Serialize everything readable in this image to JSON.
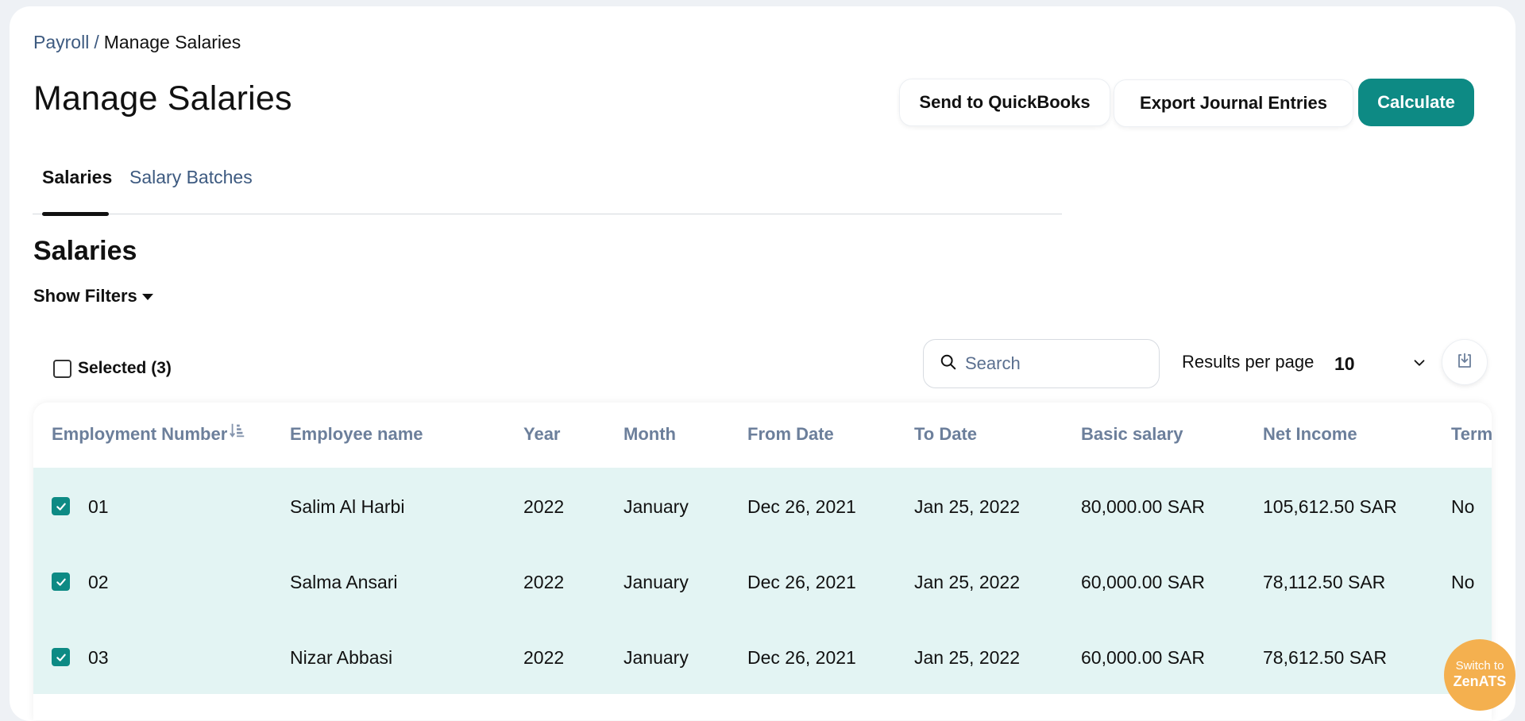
{
  "breadcrumb": {
    "parent": "Payroll",
    "separator": "/",
    "current": "Manage Salaries"
  },
  "page_title": "Manage Salaries",
  "actions": {
    "quickbooks": "Send to QuickBooks",
    "export": "Export Journal Entries",
    "calculate": "Calculate"
  },
  "colors": {
    "accent": "#0d8a84",
    "row_selected": "#e3f4f3",
    "link": "#3d5a80",
    "header_text": "#6c7f9b",
    "zenats": "#f4b04f"
  },
  "tabs": [
    {
      "label": "Salaries",
      "active": true
    },
    {
      "label": "Salary Batches",
      "active": false
    }
  ],
  "section_title": "Salaries",
  "filters": {
    "label": "Show Filters"
  },
  "selection": {
    "label": "Selected (3)"
  },
  "search": {
    "placeholder": "Search",
    "value": ""
  },
  "pagination": {
    "label": "Results per page",
    "value": "10"
  },
  "table": {
    "headers": [
      "Employment Number",
      "Employee name",
      "Year",
      "Month",
      "From Date",
      "To Date",
      "Basic salary",
      "Net Income",
      "Term"
    ],
    "rows": [
      {
        "checked": true,
        "cells": [
          "01",
          "Salim Al Harbi",
          "2022",
          "January",
          "Dec 26, 2021",
          "Jan 25, 2022",
          "80,000.00 SAR",
          "105,612.50 SAR",
          "No"
        ]
      },
      {
        "checked": true,
        "cells": [
          "02",
          "Salma Ansari",
          "2022",
          "January",
          "Dec 26, 2021",
          "Jan 25, 2022",
          "60,000.00 SAR",
          "78,112.50 SAR",
          "No"
        ]
      },
      {
        "checked": true,
        "cells": [
          "03",
          "Nizar Abbasi",
          "2022",
          "January",
          "Dec 26, 2021",
          "Jan 25, 2022",
          "60,000.00 SAR",
          "78,612.50 SAR",
          ""
        ]
      }
    ]
  },
  "widget": {
    "line1": "Switch to",
    "line2": "ZenATS"
  }
}
